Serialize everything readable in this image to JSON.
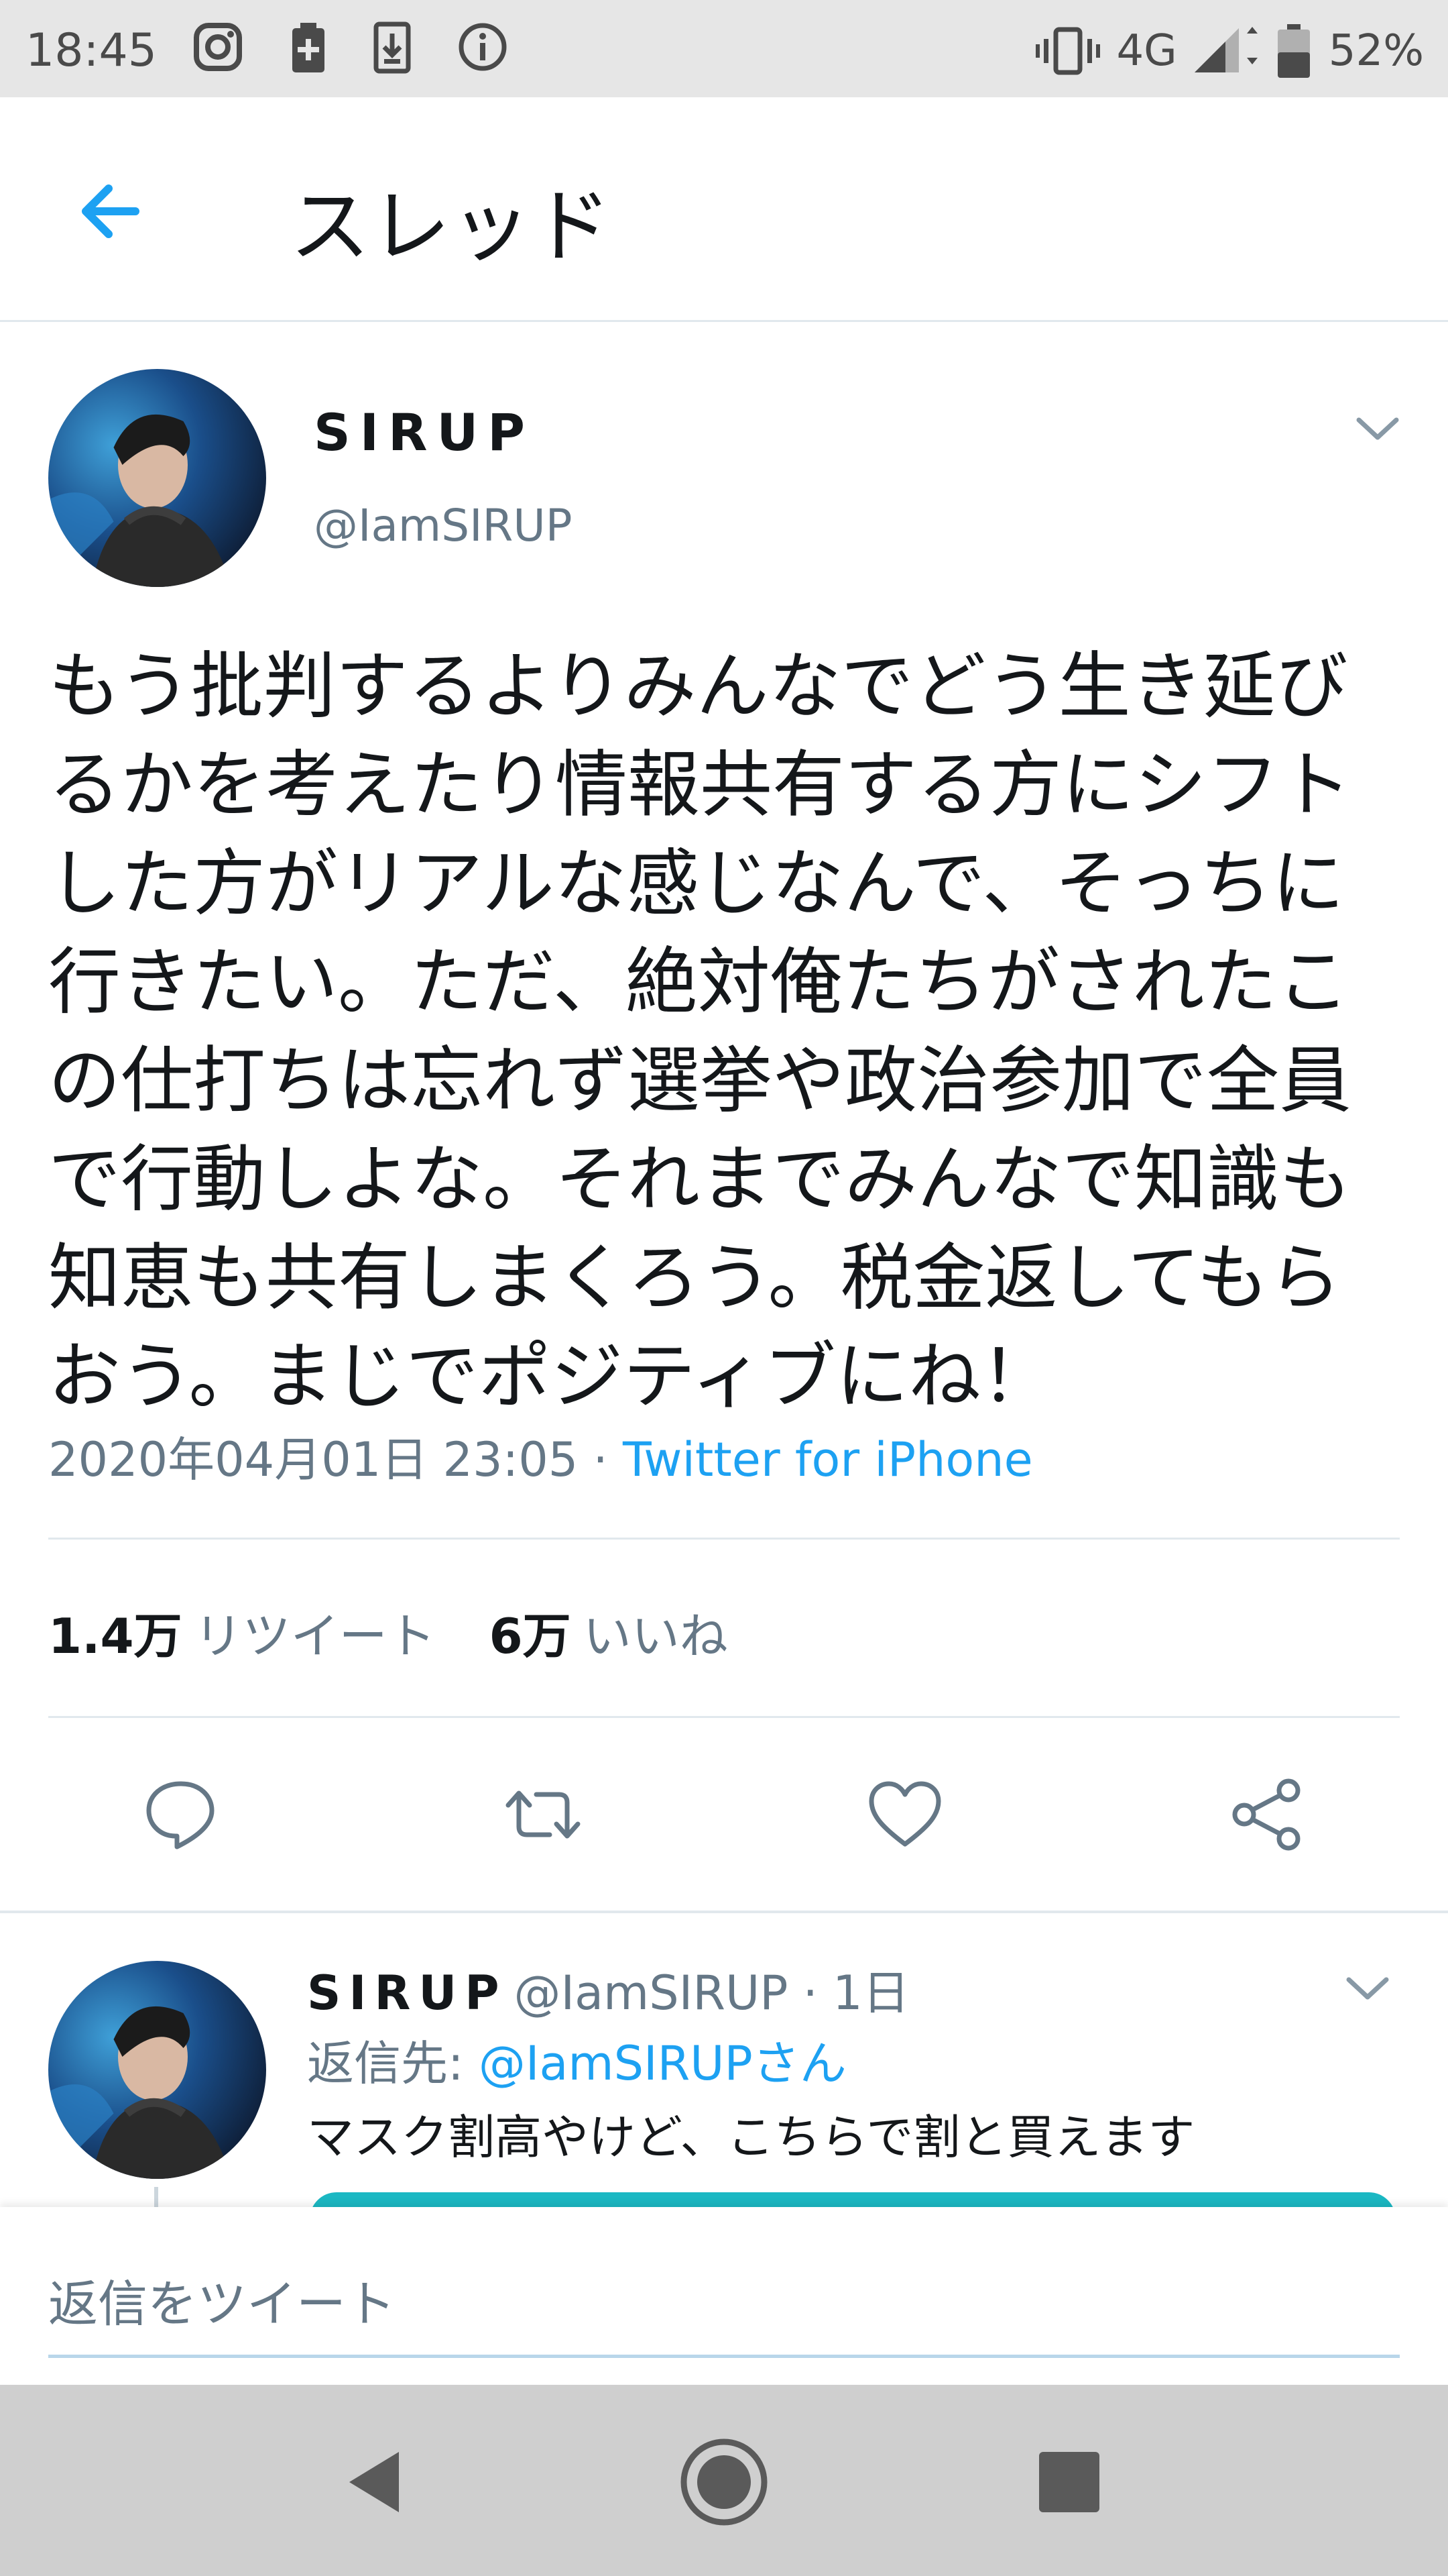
{
  "status_bar": {
    "time": "18:45",
    "network": "4G",
    "battery": "52%",
    "icons": [
      "instagram-icon",
      "battery-saver-icon",
      "download-icon",
      "info-icon",
      "vibrate-icon",
      "signal-icon",
      "battery-icon"
    ]
  },
  "header": {
    "back_icon": "arrow-left-icon",
    "title": "スレッド"
  },
  "tweet": {
    "display_name": "SIRUP",
    "handle": "@IamSIRUP",
    "lines": [
      "もう批判するよりみんなでどう生き延び",
      "るかを考えたり情報共有する方にシフト",
      "した方がリアルな感じなんで、そっちに",
      "行きたい。ただ、絶対俺たちがされたこ",
      "の仕打ちは忘れず選挙や政治参加で全員",
      "で行動しよな。それまでみんなで知識も",
      "知恵も共有しまくろう。税金返してもら",
      "おう。まじでポジティブにね！"
    ],
    "timestamp": "2020年04月01日 23:05",
    "separator": " · ",
    "source": "Twitter for iPhone",
    "retweets_count": "1.4万",
    "retweets_label": "リツイート",
    "likes_count": "6万",
    "likes_label": "いいね",
    "actions": [
      "reply-icon",
      "retweet-icon",
      "like-icon",
      "share-icon"
    ]
  },
  "reply": {
    "display_name": "SIRUP",
    "handle": "@IamSIRUP",
    "age": " · 1日",
    "reply_to_prefix": "返信先: ",
    "reply_to_mention": "@IamSIRUPさん",
    "text": "マスク割高やけど、こちらで割と買えます"
  },
  "compose": {
    "placeholder": "返信をツイート"
  },
  "colors": {
    "accent": "#1da1f2",
    "muted": "#657786",
    "divider": "#e1e8ed",
    "card": "#1bb8c3"
  }
}
